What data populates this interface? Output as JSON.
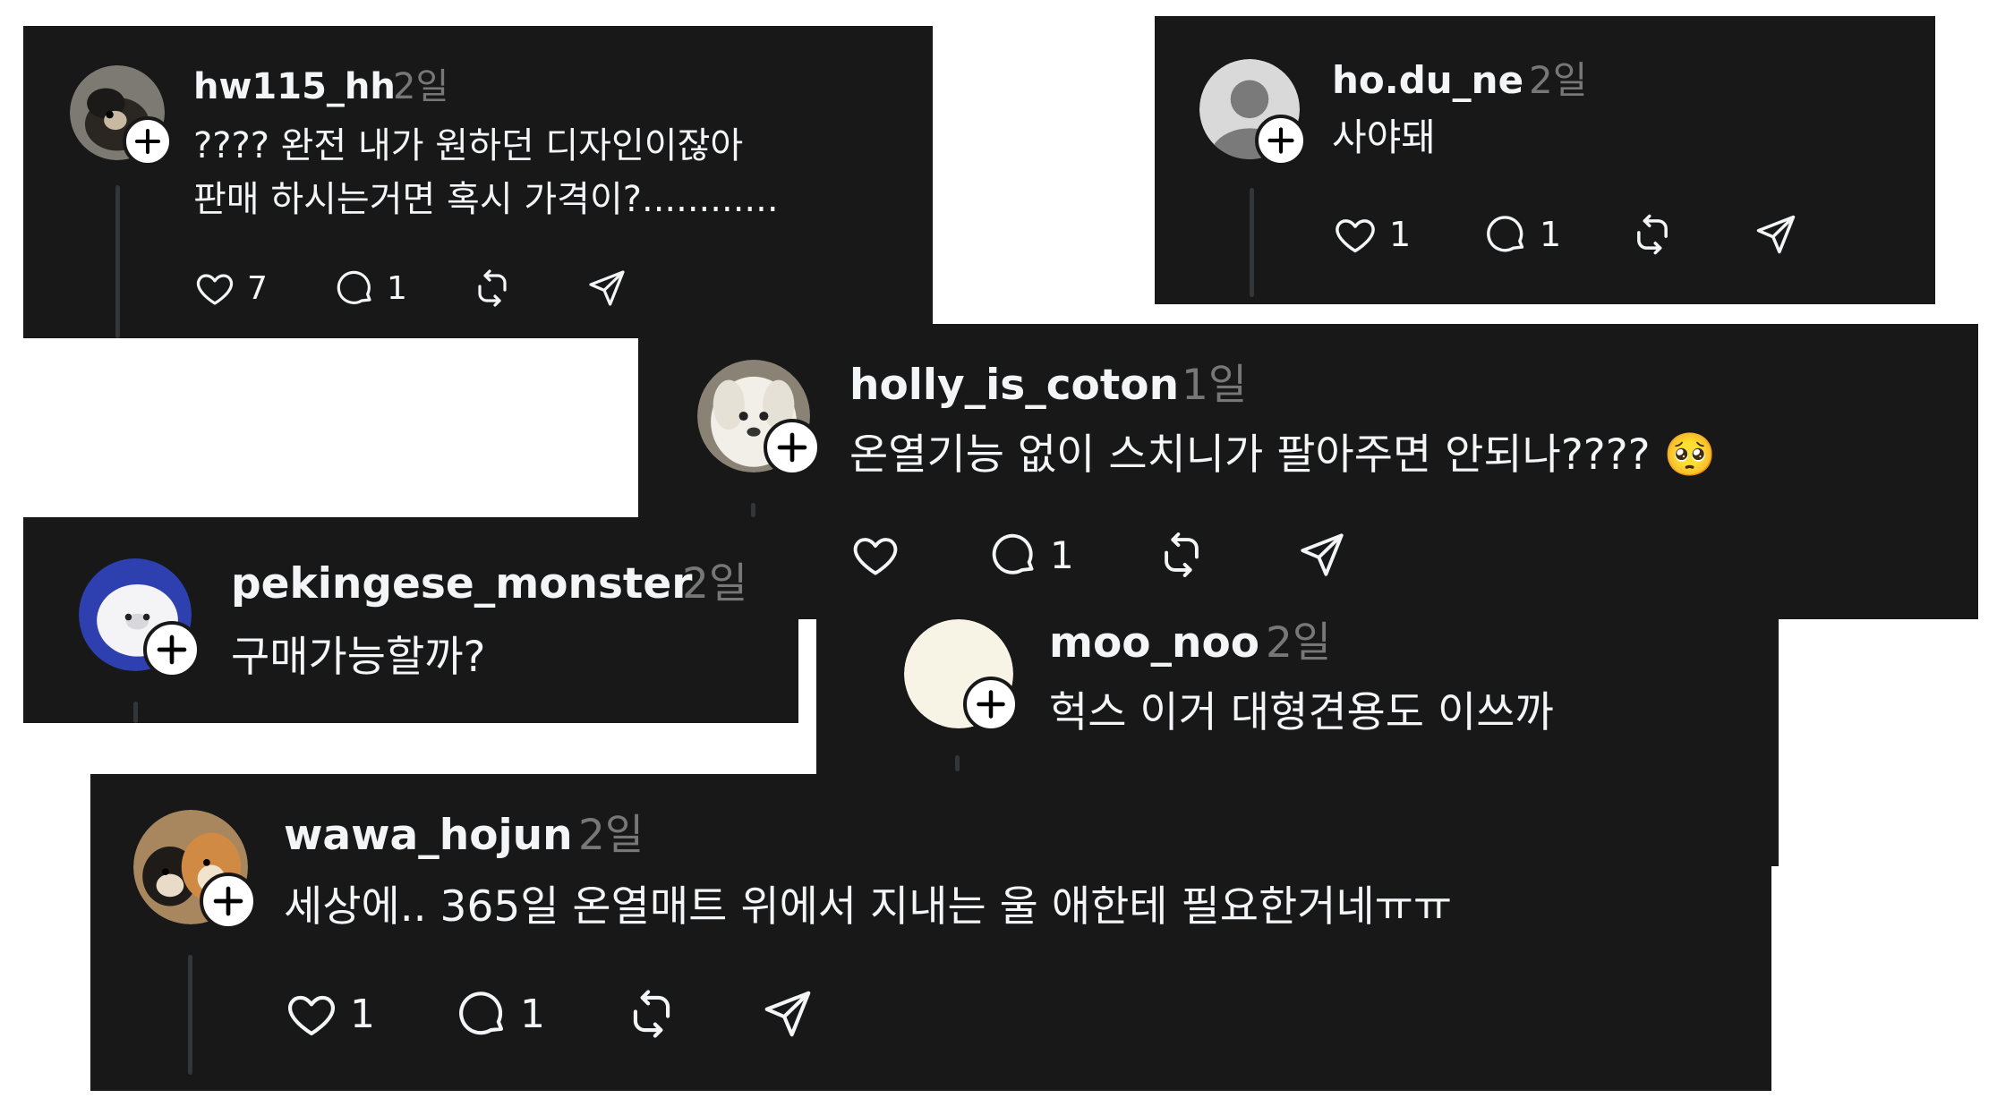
{
  "colors": {
    "card_bg": "#181818",
    "text": "#f3f5f7",
    "muted": "#777777",
    "line": "#333638"
  },
  "comments": [
    {
      "username": "hw115_hh",
      "time": "2일",
      "lines": [
        "???? 완전 내가 원하던 디자인이잖아",
        "판매 하시는거면 혹시 가격이?............"
      ],
      "likes": "7",
      "replies": "1"
    },
    {
      "username": "ho.du_ne",
      "time": "2일",
      "lines": [
        "사야돼"
      ],
      "likes": "1",
      "replies": "1"
    },
    {
      "username": "holly_is_coton",
      "time": "1일",
      "lines": [
        "온열기능 없이 스치니가 팔아주면 안되나???? 🥺"
      ],
      "likes": "",
      "replies": "1"
    },
    {
      "username": "pekingese_monster",
      "time": "2일",
      "lines": [
        "구매가능할까?"
      ]
    },
    {
      "username": "moo_noo",
      "time": "2일",
      "lines": [
        "헉스 이거 대형견용도 이쓰까"
      ]
    },
    {
      "username": "wawa_hojun",
      "time": "2일",
      "lines": [
        "세상에.. 365일 온열매트 위에서 지내는 울 애한테 필요한거네ㅠㅠ"
      ],
      "likes": "1",
      "replies": "1"
    }
  ],
  "icons": [
    "heart-icon",
    "comment-icon",
    "repost-icon",
    "share-icon",
    "follow-plus-icon"
  ]
}
